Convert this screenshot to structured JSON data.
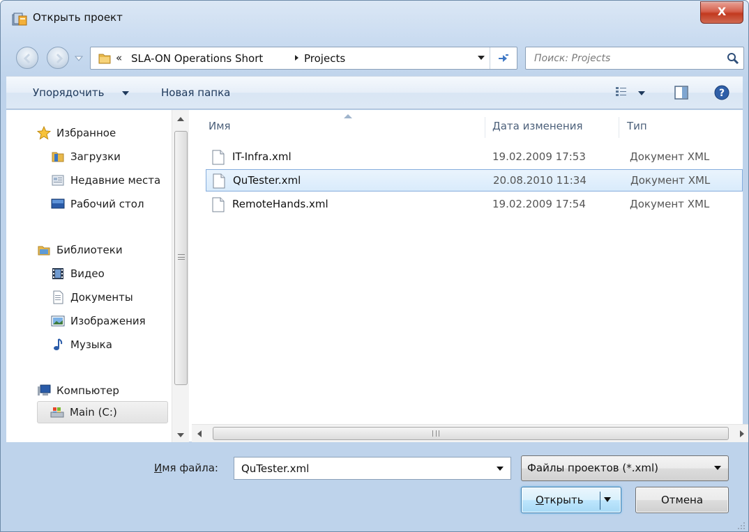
{
  "window": {
    "title": "Открыть проект",
    "close_label": "X"
  },
  "address": {
    "overflow": "«",
    "crumbs": [
      "SLA-ON Operations Short",
      "Projects"
    ]
  },
  "search": {
    "placeholder": "Поиск: Projects"
  },
  "toolbar": {
    "organize_label": "Упорядочить",
    "new_folder_label": "Новая папка"
  },
  "nav": {
    "favorites_label": "Избранное",
    "downloads_label": "Загрузки",
    "recent_label": "Недавние места",
    "desktop_label": "Рабочий стол",
    "libraries_label": "Библиотеки",
    "video_label": "Видео",
    "documents_label": "Документы",
    "pictures_label": "Изображения",
    "music_label": "Музыка",
    "computer_label": "Компьютер",
    "drive_label": "Main (C:)"
  },
  "columns": {
    "name": "Имя",
    "date": "Дата изменения",
    "type": "Тип"
  },
  "files": [
    {
      "name": "IT-Infra.xml",
      "date": "19.02.2009 17:53",
      "type": "Документ XML"
    },
    {
      "name": "QuTester.xml",
      "date": "20.08.2010 11:34",
      "type": "Документ XML"
    },
    {
      "name": "RemoteHands.xml",
      "date": "19.02.2009 17:54",
      "type": "Документ XML"
    }
  ],
  "footer": {
    "filename_label_prefix": "И",
    "filename_label_rest": "мя файла:",
    "filename_value": "QuTester.xml",
    "filetype_value": "Файлы проектов (*.xml)",
    "open_label_prefix": "О",
    "open_label_rest": "ткрыть",
    "cancel_label": "Отмена"
  },
  "colors": {
    "selection_border": "#84acdd",
    "close_button": "#c2391f",
    "link_text": "#1e395b"
  }
}
